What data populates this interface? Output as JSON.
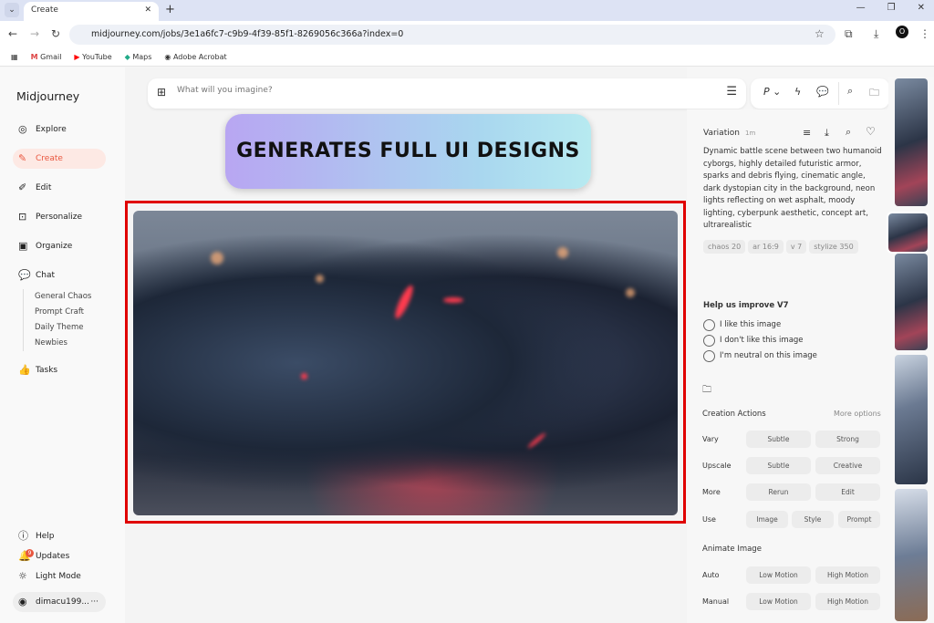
{
  "browser": {
    "tab_title": "Create",
    "url": "midjourney.com/jobs/3e1a6fc7-c9b9-4f39-85f1-8269056c366a?index=0",
    "bookmarks": [
      "Gmail",
      "YouTube",
      "Maps",
      "Adobe Acrobat"
    ]
  },
  "sidebar": {
    "logo": "Midjourney",
    "items": [
      {
        "label": "Explore",
        "icon": "compass-icon"
      },
      {
        "label": "Create",
        "icon": "paintbrush-icon"
      },
      {
        "label": "Edit",
        "icon": "edit-icon"
      },
      {
        "label": "Personalize",
        "icon": "personalize-icon"
      },
      {
        "label": "Organize",
        "icon": "image-icon"
      },
      {
        "label": "Chat",
        "icon": "chat-icon"
      }
    ],
    "chat_rooms": [
      "General Chaos",
      "Prompt Craft",
      "Daily Theme",
      "Newbies"
    ],
    "tasks": "Tasks",
    "help": "Help",
    "updates": "Updates",
    "updates_badge": "9",
    "light_mode": "Light Mode",
    "user": "dimacu199...",
    "user_more": "···"
  },
  "prompt": {
    "placeholder": "What will you imagine?",
    "personalize": "P"
  },
  "banner": "GENERATES FULL UI DESIGNS",
  "details": {
    "title": "Variation",
    "age": "1m",
    "prompt": "Dynamic battle scene between two humanoid cyborgs, highly detailed futuristic armor, sparks and debris flying, cinematic angle, dark dystopian city in the background, neon lights reflecting on wet asphalt, moody lighting, cyberpunk aesthetic, concept art, ultrarealistic",
    "params": [
      "chaos 20",
      "ar 16:9",
      "v 7",
      "stylize 350"
    ],
    "feedback": {
      "title": "Help us improve V7",
      "options": [
        "I like this image",
        "I don't like this image",
        "I'm neutral on this image"
      ]
    },
    "creation": {
      "title": "Creation Actions",
      "more": "More options",
      "rows": [
        {
          "label": "Vary",
          "buttons": [
            "Subtle",
            "Strong"
          ]
        },
        {
          "label": "Upscale",
          "buttons": [
            "Subtle",
            "Creative"
          ]
        },
        {
          "label": "More",
          "buttons": [
            "Rerun",
            "Edit"
          ]
        },
        {
          "label": "Use",
          "buttons": [
            "Image",
            "Style",
            "Prompt"
          ]
        }
      ]
    },
    "animate": {
      "title": "Animate Image",
      "rows": [
        {
          "label": "Auto",
          "buttons": [
            "Low Motion",
            "High Motion"
          ]
        },
        {
          "label": "Manual",
          "buttons": [
            "Low Motion",
            "High Motion"
          ]
        }
      ]
    }
  }
}
